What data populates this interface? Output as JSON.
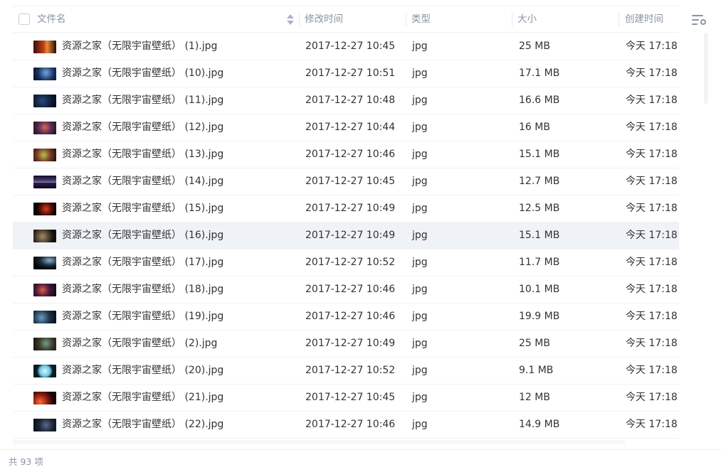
{
  "header": {
    "name_label": "文件名",
    "modified_label": "修改时间",
    "type_label": "类型",
    "size_label": "大小",
    "created_label": "创建时间"
  },
  "files": [
    {
      "name": "资源之家（无限宇宙壁纸） (1).jpg",
      "modified": "2017-12-27 10:45",
      "type": "jpg",
      "size": "25 MB",
      "created": "今天 17:18"
    },
    {
      "name": "资源之家（无限宇宙壁纸） (10).jpg",
      "modified": "2017-12-27 10:51",
      "type": "jpg",
      "size": "17.1 MB",
      "created": "今天 17:18"
    },
    {
      "name": "资源之家（无限宇宙壁纸） (11).jpg",
      "modified": "2017-12-27 10:48",
      "type": "jpg",
      "size": "16.6 MB",
      "created": "今天 17:18"
    },
    {
      "name": "资源之家（无限宇宙壁纸） (12).jpg",
      "modified": "2017-12-27 10:44",
      "type": "jpg",
      "size": "16 MB",
      "created": "今天 17:18"
    },
    {
      "name": "资源之家（无限宇宙壁纸） (13).jpg",
      "modified": "2017-12-27 10:46",
      "type": "jpg",
      "size": "15.1 MB",
      "created": "今天 17:18"
    },
    {
      "name": "资源之家（无限宇宙壁纸） (14).jpg",
      "modified": "2017-12-27 10:45",
      "type": "jpg",
      "size": "12.7 MB",
      "created": "今天 17:18"
    },
    {
      "name": "资源之家（无限宇宙壁纸） (15).jpg",
      "modified": "2017-12-27 10:49",
      "type": "jpg",
      "size": "12.5 MB",
      "created": "今天 17:18"
    },
    {
      "name": "资源之家（无限宇宙壁纸） (16).jpg",
      "modified": "2017-12-27 10:49",
      "type": "jpg",
      "size": "15.1 MB",
      "created": "今天 17:18"
    },
    {
      "name": "资源之家（无限宇宙壁纸） (17).jpg",
      "modified": "2017-12-27 10:52",
      "type": "jpg",
      "size": "11.7 MB",
      "created": "今天 17:18"
    },
    {
      "name": "资源之家（无限宇宙壁纸） (18).jpg",
      "modified": "2017-12-27 10:46",
      "type": "jpg",
      "size": "10.1 MB",
      "created": "今天 17:18"
    },
    {
      "name": "资源之家（无限宇宙壁纸） (19).jpg",
      "modified": "2017-12-27 10:46",
      "type": "jpg",
      "size": "19.9 MB",
      "created": "今天 17:18"
    },
    {
      "name": "资源之家（无限宇宙壁纸） (2).jpg",
      "modified": "2017-12-27 10:49",
      "type": "jpg",
      "size": "25 MB",
      "created": "今天 17:18"
    },
    {
      "name": "资源之家（无限宇宙壁纸） (20).jpg",
      "modified": "2017-12-27 10:52",
      "type": "jpg",
      "size": "9.1 MB",
      "created": "今天 17:18"
    },
    {
      "name": "资源之家（无限宇宙壁纸） (21).jpg",
      "modified": "2017-12-27 10:45",
      "type": "jpg",
      "size": "12 MB",
      "created": "今天 17:18"
    },
    {
      "name": "资源之家（无限宇宙壁纸） (22).jpg",
      "modified": "2017-12-27 10:46",
      "type": "jpg",
      "size": "14.9 MB",
      "created": "今天 17:18"
    }
  ],
  "selected_row": "资源之家（无限宇宙壁纸） (16).jpg",
  "thumbnail_style": "image-thumbnail",
  "footer": {
    "count_text": "共 93 项"
  },
  "colors": {
    "header_text": "#8a93a6",
    "row_text": "#333333",
    "selected_bg": "#eff2f7"
  }
}
